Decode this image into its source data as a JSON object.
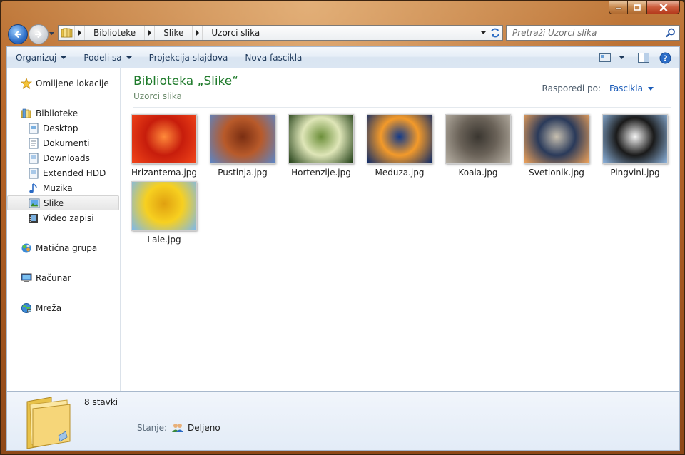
{
  "window": {
    "caption_buttons": [
      "minimize-icon",
      "maximize-icon",
      "close-icon"
    ]
  },
  "address": {
    "segments": [
      "Biblioteke",
      "Slike",
      "Uzorci slika"
    ]
  },
  "search": {
    "placeholder": "Pretraži Uzorci slika"
  },
  "toolbar": {
    "items": [
      {
        "label": "Organizuj",
        "dropdown": true
      },
      {
        "label": "Podeli sa",
        "dropdown": true
      },
      {
        "label": "Projekcija slajdova",
        "dropdown": false
      },
      {
        "label": "Nova fascikla",
        "dropdown": false
      }
    ]
  },
  "navpane": {
    "favorites": "Omiljene lokacije",
    "libraries": "Biblioteke",
    "library_items": [
      "Desktop",
      "Dokumenti",
      "Downloads",
      "Extended HDD",
      "Muzika",
      "Slike",
      "Video zapisi"
    ],
    "selected": "Slike",
    "homegroup": "Matična grupa",
    "computer": "Računar",
    "network": "Mreža"
  },
  "main": {
    "title": "Biblioteka „Slike“",
    "subtitle": "Uzorci slika",
    "arrange_label": "Rasporedi po:",
    "arrange_value": "Fascikla",
    "files": [
      {
        "name": "Hrizantema.jpg",
        "colors": [
          "#f2461a",
          "#c71d0c",
          "#ff8a3a"
        ]
      },
      {
        "name": "Pustinja.jpg",
        "colors": [
          "#5a86c8",
          "#b85a2a",
          "#7a2e12"
        ]
      },
      {
        "name": "Hortenzije.jpg",
        "colors": [
          "#1c3a12",
          "#dfe6b8",
          "#6c8f3a"
        ]
      },
      {
        "name": "Meduza.jpg",
        "colors": [
          "#0c2a6a",
          "#f39a2a",
          "#123a8a"
        ]
      },
      {
        "name": "Koala.jpg",
        "colors": [
          "#b9b2a6",
          "#6a6258",
          "#3a3630"
        ]
      },
      {
        "name": "Svetionik.jpg",
        "colors": [
          "#f0a35a",
          "#2a3a5a",
          "#c8c0b0"
        ]
      },
      {
        "name": "Pingvini.jpg",
        "colors": [
          "#8fb6e0",
          "#1a1a1a",
          "#f4f4f4"
        ]
      },
      {
        "name": "Lale.jpg",
        "colors": [
          "#7ab8f0",
          "#f7d020",
          "#e0a010"
        ]
      }
    ]
  },
  "details": {
    "count": "8 stavki",
    "state_label": "Stanje:",
    "state_value": "Deljeno"
  }
}
